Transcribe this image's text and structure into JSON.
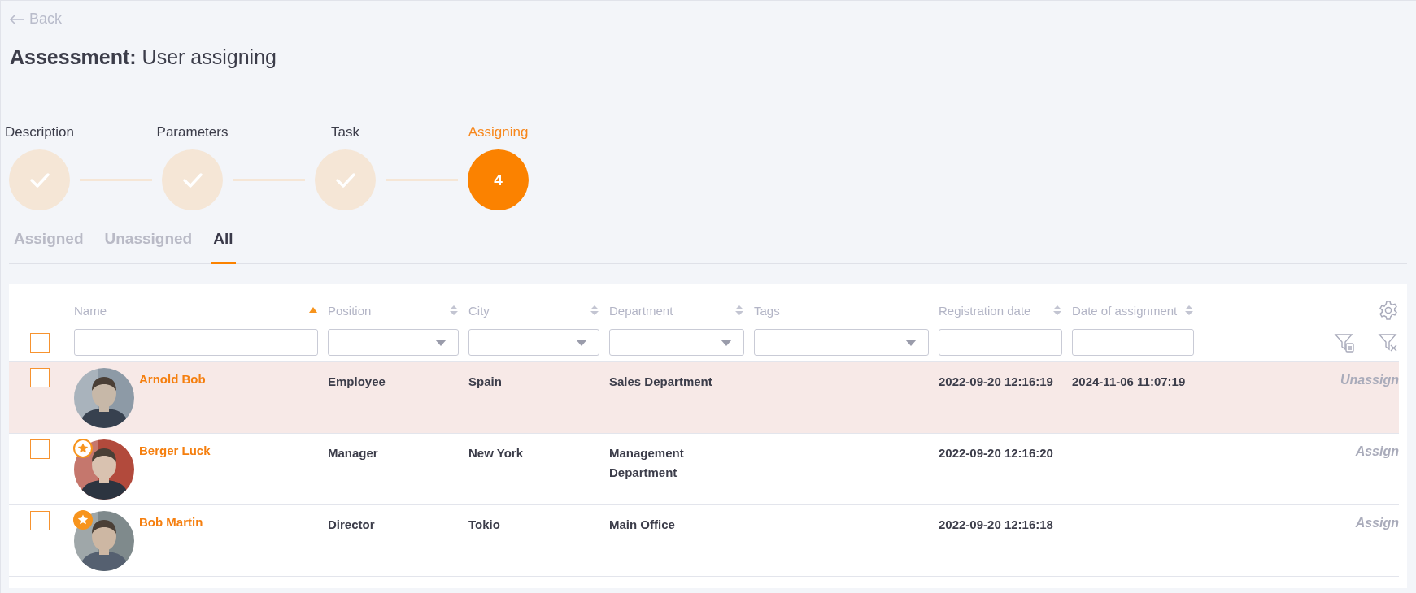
{
  "back": "Back",
  "title": "**Assessment:** User assigning",
  "steps": [
    {
      "label": "Description",
      "done": true
    },
    {
      "label": "Parameters",
      "done": true
    },
    {
      "label": "Task",
      "done": true
    },
    {
      "label": "Assigning",
      "done": false,
      "number": "4"
    }
  ],
  "tabs": [
    {
      "label": "Assigned",
      "selected": false
    },
    {
      "label": "Unassigned",
      "selected": false
    },
    {
      "label": "All",
      "selected": true
    }
  ],
  "table": {
    "select_all": {
      "checked": false
    },
    "columns": [
      {
        "label": "Name",
        "sortable": true,
        "sorted": true,
        "kind": "text"
      },
      {
        "label": "Position",
        "sortable": true,
        "sorted": false,
        "kind": "select"
      },
      {
        "label": "City",
        "sortable": true,
        "sorted": false,
        "kind": "select"
      },
      {
        "label": "Department",
        "sortable": true,
        "sorted": false,
        "kind": "select"
      },
      {
        "label": "Tags",
        "sortable": false,
        "sorted": false,
        "kind": "select"
      },
      {
        "label": "Registration date",
        "sortable": true,
        "sorted": false,
        "kind": "text"
      },
      {
        "label": "Date of assignment",
        "sortable": true,
        "sorted": false,
        "kind": "text"
      }
    ],
    "rows": [
      {
        "checked": false,
        "assigned": true,
        "name": "Arnold Bob",
        "position": "Employee",
        "city": "Spain",
        "department": "Sales Department",
        "registration_date": "2022-09-20 12:16:19",
        "date_of_assignment": "2024-11-06 11:07:19",
        "action": "Unassign"
      },
      {
        "checked": false,
        "assigned": false,
        "star": {
          "filled": false
        },
        "name": "Berger Luck",
        "position": "Manager",
        "city": "New York",
        "department": "Management Department",
        "registration_date": "2022-09-20 12:16:20",
        "action": "Assign"
      },
      {
        "checked": false,
        "assigned": false,
        "star": {
          "filled": true
        },
        "name": "Bob Martin",
        "position": "Director",
        "city": "Tokio",
        "department": "Main Office",
        "registration_date": "2022-09-20 12:16:18",
        "action": "Assign"
      }
    ]
  }
}
